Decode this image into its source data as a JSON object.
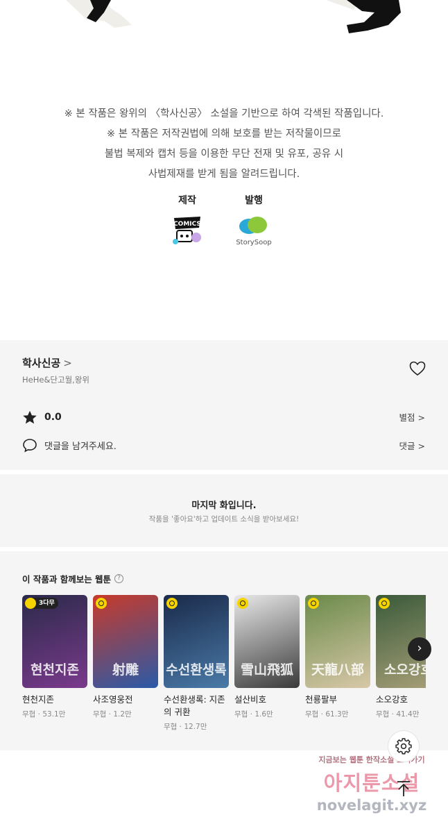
{
  "notice": {
    "lines": [
      "※ 본 작품은 왕위의 〈학사신공〉 소설을 기반으로 하여 각색된 작품입니다.",
      "※ 본 작품은 저작권법에 의해 보호를 받는 저작물이므로",
      "불법 복제와 캡처 등을 이용한 무단 전재 및 유포, 공유 시",
      "사법제재를 받게 됨을 알려드립니다."
    ]
  },
  "credits": {
    "maker_label": "제작",
    "maker_logo_text": "COMICS",
    "publisher_label": "발행",
    "publisher_logo_text": "StorySoop"
  },
  "series": {
    "title": "학사신공",
    "chevron": ">",
    "authors": "HeHe&단고월,왕위",
    "rating": "0.0",
    "rating_link": "별점 >",
    "comment_prompt": "댓글을 남겨주세요.",
    "comment_link": "댓글 >"
  },
  "last_episode": {
    "title": "마지막 화입니다.",
    "subtitle": "작품을 '좋아요'하고 업데이트 소식을 받아보세요!"
  },
  "recommend": {
    "heading": "이 작품과 함께보는 웹툰",
    "help_icon": "?",
    "next_arrow": "›",
    "items": [
      {
        "title": "현천지존",
        "meta": "무협 · 53.1만",
        "badge": "3다무",
        "art": "현천지존",
        "colors": [
          "#2b2a4a",
          "#7a3a8c"
        ]
      },
      {
        "title": "사조영웅전",
        "meta": "무협 · 1.2만",
        "badge": "",
        "art": "射雕",
        "colors": [
          "#c83a2a",
          "#2a5aa8"
        ]
      },
      {
        "title": "수선환생록: 지존의 귀환",
        "meta": "무협 · 12.7만",
        "badge": "",
        "art": "수선환생록",
        "colors": [
          "#1a2a4a",
          "#4a7aa8"
        ]
      },
      {
        "title": "설산비호",
        "meta": "무협 · 1.6만",
        "badge": "",
        "art": "雪山飛狐",
        "colors": [
          "#e8e8e8",
          "#3a3a3a"
        ]
      },
      {
        "title": "천룡팔부",
        "meta": "무협 · 61.3만",
        "badge": "",
        "art": "天龍八部",
        "colors": [
          "#6a8a4a",
          "#d8c8a8"
        ]
      },
      {
        "title": "소오강호",
        "meta": "무협 · 41.4만",
        "badge": "",
        "art": "소오강호",
        "colors": [
          "#3a5a3a",
          "#a8a078"
        ]
      }
    ]
  },
  "watermark": {
    "line1": "지금보는 웹툰 한작소설 보러가기",
    "line2": "아지툰소설",
    "line3": "novelagit.xyz"
  }
}
